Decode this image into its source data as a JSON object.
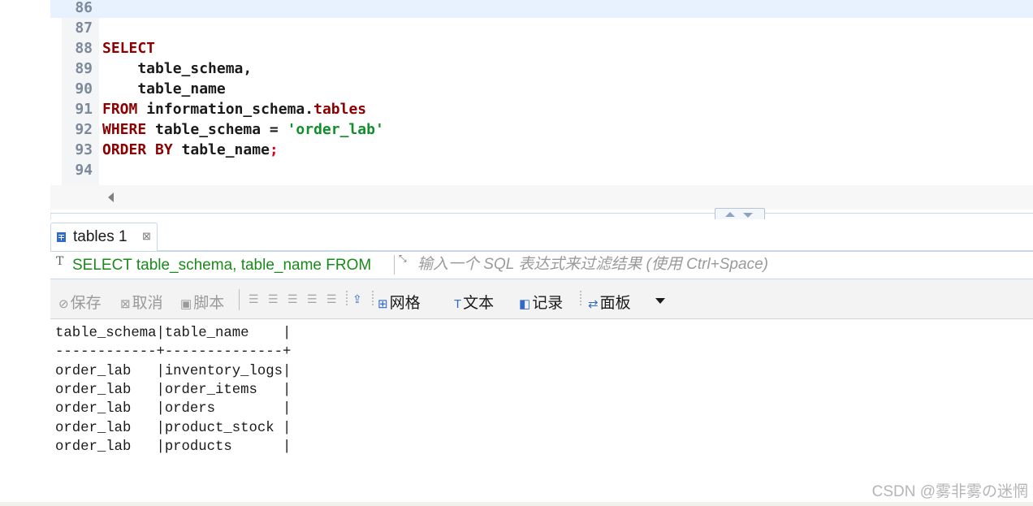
{
  "editor": {
    "lines": [
      {
        "num": "86",
        "tokens": []
      },
      {
        "num": "87",
        "tokens": []
      },
      {
        "num": "88",
        "tokens": [
          {
            "t": "SELECT",
            "c": "kw"
          }
        ]
      },
      {
        "num": "89",
        "tokens": [
          {
            "t": "    table_schema,",
            "c": ""
          }
        ]
      },
      {
        "num": "90",
        "tokens": [
          {
            "t": "    table_name",
            "c": ""
          }
        ]
      },
      {
        "num": "91",
        "tokens": [
          {
            "t": "FROM",
            "c": "kw"
          },
          {
            "t": " information_schema.",
            "c": ""
          },
          {
            "t": "tables",
            "c": "kw"
          }
        ]
      },
      {
        "num": "92",
        "tokens": [
          {
            "t": "WHERE",
            "c": "kw"
          },
          {
            "t": " table_schema = ",
            "c": ""
          },
          {
            "t": "'order_lab'",
            "c": "str"
          }
        ]
      },
      {
        "num": "93",
        "tokens": [
          {
            "t": "ORDER BY",
            "c": "kw"
          },
          {
            "t": " table_name",
            "c": ""
          },
          {
            "t": ";",
            "c": "semi"
          }
        ]
      },
      {
        "num": "94",
        "tokens": []
      }
    ]
  },
  "results_tab": {
    "label": "tables 1",
    "close_glyph": "⊠"
  },
  "filter": {
    "t_glyph": "T",
    "query": "SELECT table_schema, table_name FROM",
    "expand_glyph": "⤡",
    "placeholder": "输入一个 SQL 表达式来过滤结果 (使用 Ctrl+Space)"
  },
  "toolbar": {
    "save": "保存",
    "cancel": "取消",
    "script": "脚本",
    "grid": "网格",
    "text": "文本",
    "record": "记录",
    "panel": "面板"
  },
  "results": {
    "lines": [
      "table_schema|table_name    |",
      "------------+--------------+",
      "order_lab   |inventory_logs|",
      "order_lab   |order_items   |",
      "order_lab   |orders        |",
      "order_lab   |product_stock |",
      "order_lab   |products      |"
    ]
  },
  "watermark": "CSDN @雾非雾の迷惘"
}
